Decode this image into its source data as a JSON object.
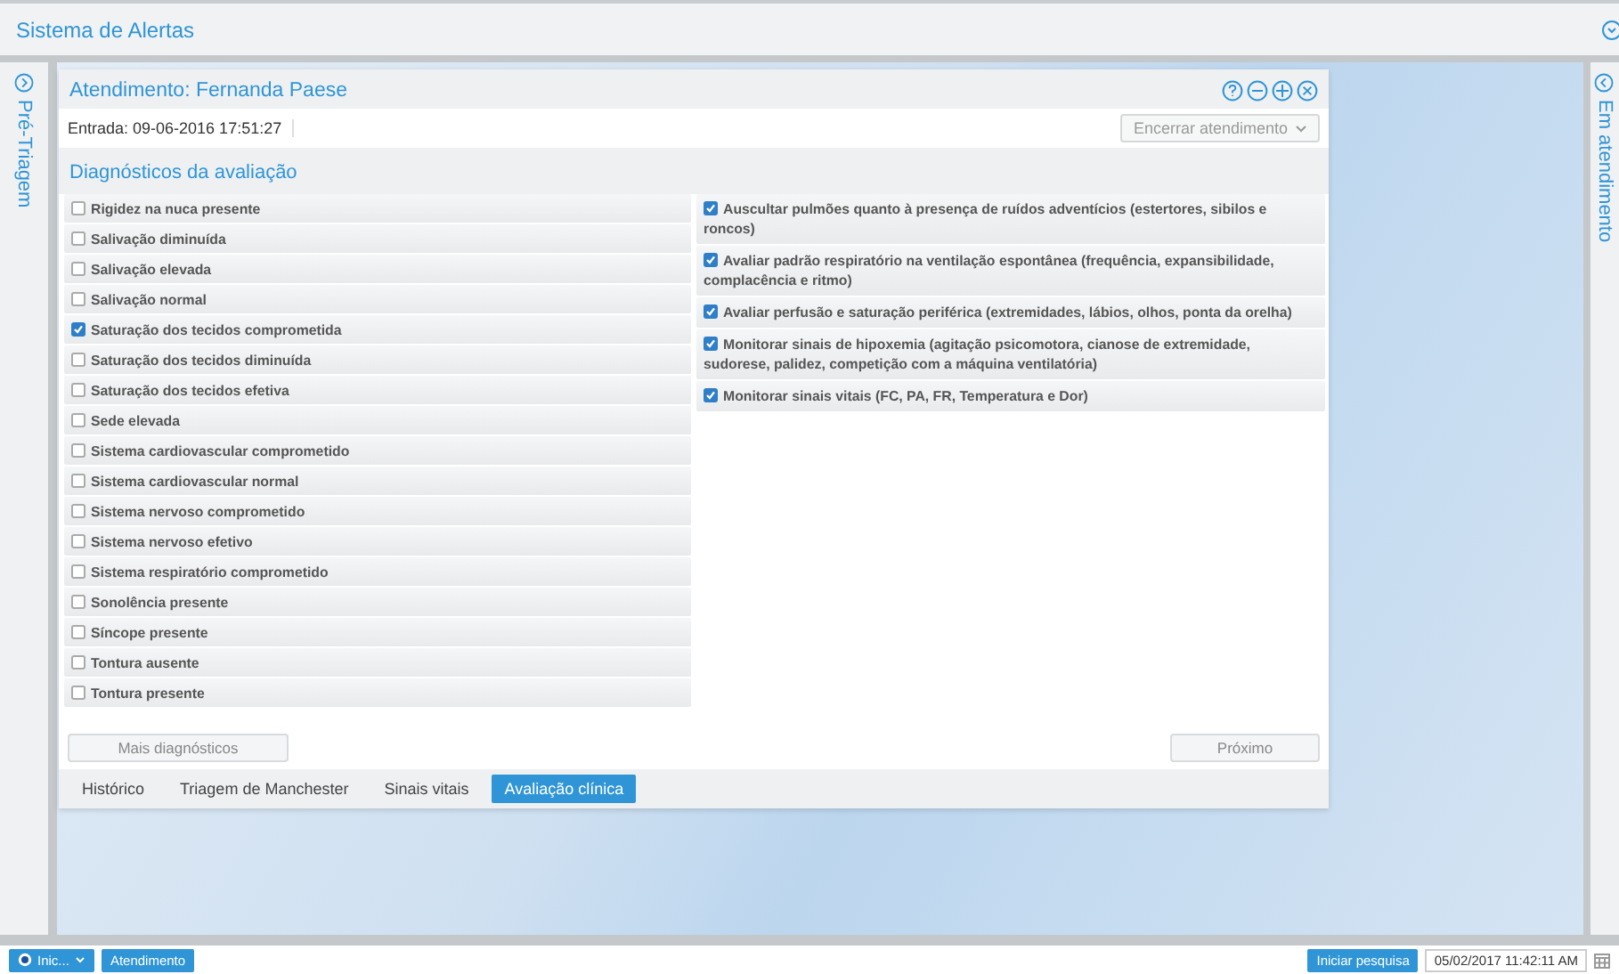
{
  "header": {
    "title": "Sistema de Alertas"
  },
  "left_panel": {
    "label": "Pré-Triagem"
  },
  "right_panel": {
    "label": "Em atendimento"
  },
  "dialog": {
    "title": "Atendimento: Fernanda Paese",
    "entry": "Entrada: 09-06-2016 17:51:27",
    "action_dropdown": "Encerrar atendimento",
    "section_title": "Diagnósticos da avaliação",
    "diagnoses": [
      {
        "label": "Rigidez na nuca presente",
        "checked": false
      },
      {
        "label": "Salivação diminuída",
        "checked": false
      },
      {
        "label": "Salivação elevada",
        "checked": false
      },
      {
        "label": "Salivação normal",
        "checked": false
      },
      {
        "label": "Saturação dos tecidos comprometida",
        "checked": true
      },
      {
        "label": "Saturação dos tecidos diminuída",
        "checked": false
      },
      {
        "label": "Saturação dos tecidos efetiva",
        "checked": false
      },
      {
        "label": "Sede elevada",
        "checked": false
      },
      {
        "label": "Sistema cardiovascular comprometido",
        "checked": false
      },
      {
        "label": "Sistema cardiovascular normal",
        "checked": false
      },
      {
        "label": "Sistema nervoso comprometido",
        "checked": false
      },
      {
        "label": "Sistema nervoso efetivo",
        "checked": false
      },
      {
        "label": "Sistema respiratório comprometido",
        "checked": false
      },
      {
        "label": "Sonolência presente",
        "checked": false
      },
      {
        "label": "Síncope presente",
        "checked": false
      },
      {
        "label": "Tontura ausente",
        "checked": false
      },
      {
        "label": "Tontura presente",
        "checked": false
      }
    ],
    "interventions": [
      {
        "label": "Auscultar pulmões quanto à presença de ruídos adventícios (estertores, sibilos e roncos)",
        "checked": true
      },
      {
        "label": "Avaliar padrão respiratório na ventilação espontânea (frequência, expansibilidade, complacência e ritmo)",
        "checked": true
      },
      {
        "label": "Avaliar perfusão e saturação periférica (extremidades, lábios, olhos, ponta da orelha)",
        "checked": true
      },
      {
        "label": "Monitorar sinais de hipoxemia (agitação psicomotora, cianose de extremidade, sudorese, palidez, competição com a máquina ventilatória)",
        "checked": true
      },
      {
        "label": "Monitorar sinais vitais (FC, PA, FR, Temperatura e Dor)",
        "checked": true
      }
    ],
    "more_button": "Mais diagnósticos",
    "next_button": "Próximo",
    "tabs": [
      {
        "label": "Histórico",
        "selected": false
      },
      {
        "label": "Triagem de Manchester",
        "selected": false
      },
      {
        "label": "Sinais vitais",
        "selected": false
      },
      {
        "label": "Avaliação clínica",
        "selected": true
      }
    ]
  },
  "taskbar": {
    "start": "Inic...",
    "apps": [
      "Atendimento"
    ],
    "search_button": "Iniciar pesquisa",
    "datetime": "05/02/2017 11:42:11 AM"
  }
}
